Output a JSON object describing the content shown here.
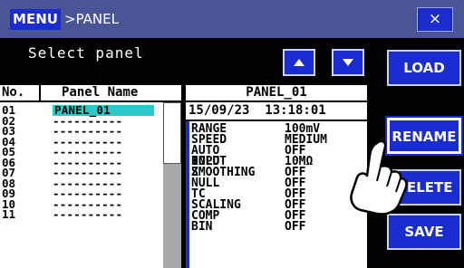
{
  "header": {
    "menu": "MENU",
    "breadcrumb": ">PANEL",
    "close": "×"
  },
  "prompt": "Select panel",
  "buttons": {
    "load": "LOAD",
    "rename": "RENAME",
    "delete": "DELETE",
    "save": "SAVE"
  },
  "list": {
    "col_no": "No.",
    "col_name": "Panel Name",
    "rows": [
      {
        "no": "01",
        "name": "PANEL_01"
      },
      {
        "no": "02",
        "name": "----------"
      },
      {
        "no": "03",
        "name": "----------"
      },
      {
        "no": "04",
        "name": "----------"
      },
      {
        "no": "05",
        "name": "----------"
      },
      {
        "no": "06",
        "name": "----------"
      },
      {
        "no": "07",
        "name": "----------"
      },
      {
        "no": "08",
        "name": "----------"
      },
      {
        "no": "09",
        "name": "----------"
      },
      {
        "no": "10",
        "name": "----------"
      },
      {
        "no": "11",
        "name": "----------"
      }
    ]
  },
  "detail": {
    "title": "PANEL_01",
    "datetime": "15/09/23  13:18:01",
    "settings": [
      {
        "key": "RANGE",
        "value": "100mV"
      },
      {
        "key": "SPEED",
        "value": "MEDIUM"
      },
      {
        "key": "AUTO HOLD",
        "value": "OFF"
      },
      {
        "key": "INPUT Z",
        "value": "10MΩ"
      },
      {
        "key": "SMOOTHING",
        "value": "OFF"
      },
      {
        "key": "NULL",
        "value": "OFF"
      },
      {
        "key": "TC",
        "value": "OFF"
      },
      {
        "key": "SCALING",
        "value": "OFF"
      },
      {
        "key": "COMP",
        "value": "OFF"
      },
      {
        "key": "BIN",
        "value": "OFF"
      }
    ]
  },
  "icons": {
    "up": "arrow-up-icon",
    "down": "arrow-down-icon",
    "hand": "pointing-hand-icon"
  }
}
